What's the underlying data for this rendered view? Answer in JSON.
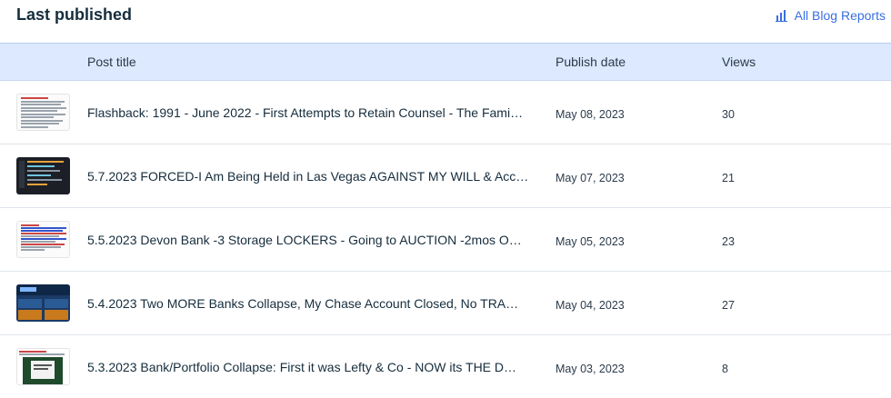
{
  "header": {
    "title": "Last published",
    "reports_link": "All Blog Reports",
    "reports_icon": "bar-chart-icon"
  },
  "table": {
    "columns": {
      "title": "Post title",
      "date": "Publish date",
      "views": "Views"
    },
    "rows": [
      {
        "title": "Flashback: 1991 - June 2022 - First Attempts to Retain Counsel - The Fami…",
        "date": "May 08, 2023",
        "views": "30"
      },
      {
        "title": "5.7.2023 FORCED-I Am Being Held in Las Vegas AGAINST MY WILL & Acc…",
        "date": "May 07, 2023",
        "views": "21"
      },
      {
        "title": "5.5.2023 Devon Bank -3 Storage LOCKERS - Going to AUCTION -2mos O…",
        "date": "May 05, 2023",
        "views": "23"
      },
      {
        "title": "5.4.2023 Two MORE Banks Collapse, My Chase Account Closed, No TRA…",
        "date": "May 04, 2023",
        "views": "27"
      },
      {
        "title": "5.3.2023 Bank/Portfolio Collapse: First it was Lefty & Co - NOW its THE D…",
        "date": "May 03, 2023",
        "views": "8"
      }
    ]
  },
  "colors": {
    "accent": "#3a6fe0",
    "header_bg": "#dce9ff",
    "text": "#162d3d"
  }
}
